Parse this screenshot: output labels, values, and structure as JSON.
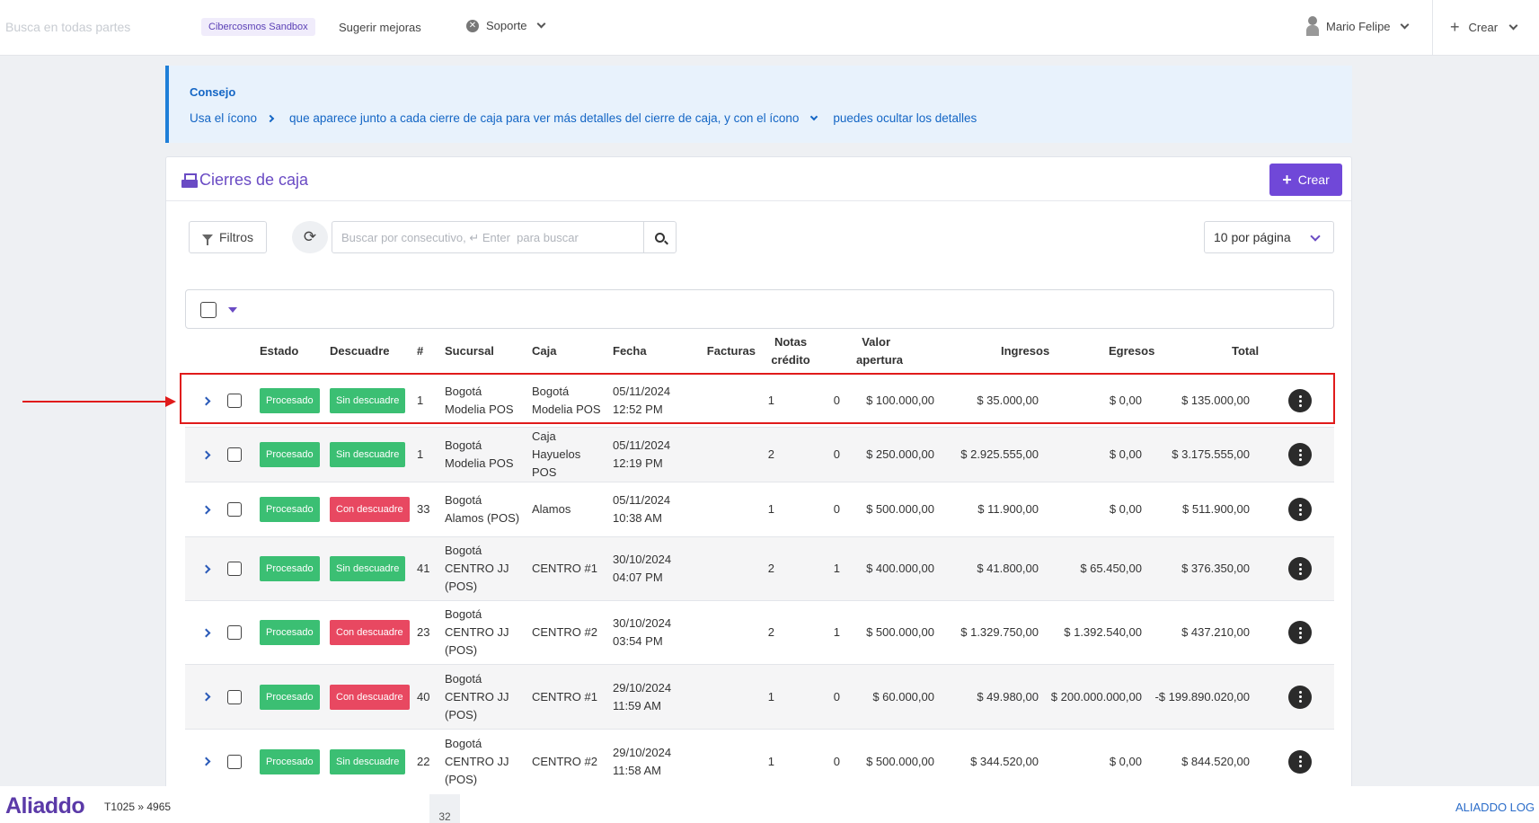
{
  "topbar": {
    "search_placeholder": "Busca en todas partes",
    "sandbox": "Cibercosmos Sandbox",
    "suggest": "Sugerir mejoras",
    "support": "Soporte",
    "user": "Mario Felipe",
    "create": "Crear"
  },
  "tip": {
    "title": "Consejo",
    "text_1": "Usa el ícono",
    "text_2": "que aparece junto a cada cierre de caja para ver más detalles del cierre de caja, y con el ícono",
    "text_3": "puedes ocultar los detalles"
  },
  "card": {
    "title": "Cierres de caja",
    "create_label": "Crear",
    "filter_label": "Filtros",
    "search_placeholder": "Buscar por consecutivo, ↵ Enter  para buscar",
    "per_page": "10 por página"
  },
  "table": {
    "headers": {
      "estado": "Estado",
      "descuadre": "Descuadre",
      "num": "#",
      "sucursal": "Sucursal",
      "caja": "Caja",
      "fecha": "Fecha",
      "facturas": "Facturas",
      "notas_1": "Notas",
      "notas_2": "crédito",
      "valor_1": "Valor",
      "valor_2": "apertura",
      "ingresos": "Ingresos",
      "egresos": "Egresos",
      "total": "Total"
    },
    "rows": [
      {
        "estado": "Procesado",
        "descuadre": "Sin descuadre",
        "desc_type": "sin",
        "num": "1",
        "sucursal_1": "Bogotá",
        "sucursal_2": "Modelia POS",
        "sucursal_3": "",
        "caja_1": "Bogotá",
        "caja_2": "Modelia POS",
        "caja_3": "",
        "fecha_1": "05/11/2024",
        "fecha_2": "12:52 PM",
        "facturas": "1",
        "notas": "0",
        "apertura": "$ 100.000,00",
        "ingresos": "$ 35.000,00",
        "egresos": "$ 0,00",
        "total": "$ 135.000,00"
      },
      {
        "estado": "Procesado",
        "descuadre": "Sin descuadre",
        "desc_type": "sin",
        "num": "1",
        "sucursal_1": "Bogotá",
        "sucursal_2": "Modelia POS",
        "sucursal_3": "",
        "caja_1": "Caja",
        "caja_2": "Hayuelos",
        "caja_3": "POS",
        "fecha_1": "05/11/2024",
        "fecha_2": "12:19 PM",
        "facturas": "2",
        "notas": "0",
        "apertura": "$ 250.000,00",
        "ingresos": "$ 2.925.555,00",
        "egresos": "$ 0,00",
        "total": "$ 3.175.555,00"
      },
      {
        "estado": "Procesado",
        "descuadre": "Con descuadre",
        "desc_type": "con",
        "num": "33",
        "sucursal_1": "Bogotá",
        "sucursal_2": "Alamos (POS)",
        "sucursal_3": "",
        "caja_1": "Alamos",
        "caja_2": "",
        "caja_3": "",
        "fecha_1": "05/11/2024",
        "fecha_2": "10:38 AM",
        "facturas": "1",
        "notas": "0",
        "apertura": "$ 500.000,00",
        "ingresos": "$ 11.900,00",
        "egresos": "$ 0,00",
        "total": "$ 511.900,00"
      },
      {
        "estado": "Procesado",
        "descuadre": "Sin descuadre",
        "desc_type": "sin",
        "num": "41",
        "sucursal_1": "Bogotá",
        "sucursal_2": "CENTRO JJ",
        "sucursal_3": "(POS)",
        "caja_1": "CENTRO #1",
        "caja_2": "",
        "caja_3": "",
        "fecha_1": "30/10/2024",
        "fecha_2": "04:07 PM",
        "facturas": "2",
        "notas": "1",
        "apertura": "$ 400.000,00",
        "ingresos": "$ 41.800,00",
        "egresos": "$ 65.450,00",
        "total": "$ 376.350,00"
      },
      {
        "estado": "Procesado",
        "descuadre": "Con descuadre",
        "desc_type": "con",
        "num": "23",
        "sucursal_1": "Bogotá",
        "sucursal_2": "CENTRO JJ",
        "sucursal_3": "(POS)",
        "caja_1": "CENTRO #2",
        "caja_2": "",
        "caja_3": "",
        "fecha_1": "30/10/2024",
        "fecha_2": "03:54 PM",
        "facturas": "2",
        "notas": "1",
        "apertura": "$ 500.000,00",
        "ingresos": "$ 1.329.750,00",
        "egresos": "$ 1.392.540,00",
        "total": "$ 437.210,00"
      },
      {
        "estado": "Procesado",
        "descuadre": "Con descuadre",
        "desc_type": "con",
        "num": "40",
        "sucursal_1": "Bogotá",
        "sucursal_2": "CENTRO JJ",
        "sucursal_3": "(POS)",
        "caja_1": "CENTRO #1",
        "caja_2": "",
        "caja_3": "",
        "fecha_1": "29/10/2024",
        "fecha_2": "11:59 AM",
        "facturas": "1",
        "notas": "0",
        "apertura": "$ 60.000,00",
        "ingresos": "$ 49.980,00",
        "egresos": "$ 200.000.000,00",
        "total": "-$ 199.890.020,00"
      },
      {
        "estado": "Procesado",
        "descuadre": "Sin descuadre",
        "desc_type": "sin",
        "num": "22",
        "sucursal_1": "Bogotá",
        "sucursal_2": "CENTRO JJ",
        "sucursal_3": "(POS)",
        "caja_1": "CENTRO #2",
        "caja_2": "",
        "caja_3": "",
        "fecha_1": "29/10/2024",
        "fecha_2": "11:58 AM",
        "facturas": "1",
        "notas": "0",
        "apertura": "$ 500.000,00",
        "ingresos": "$ 344.520,00",
        "egresos": "$ 0,00",
        "total": "$ 844.520,00"
      }
    ]
  },
  "footer": {
    "logo": "Aliaddo",
    "version": "T1025 » 4965",
    "page_number": "32",
    "log_link": "ALIADDO LOG"
  },
  "colors": {
    "accent": "#7048d8",
    "tip_text": "#1466c5",
    "badge_green": "#3bbf73",
    "badge_red": "#e84861",
    "highlight": "#e01b1b"
  }
}
